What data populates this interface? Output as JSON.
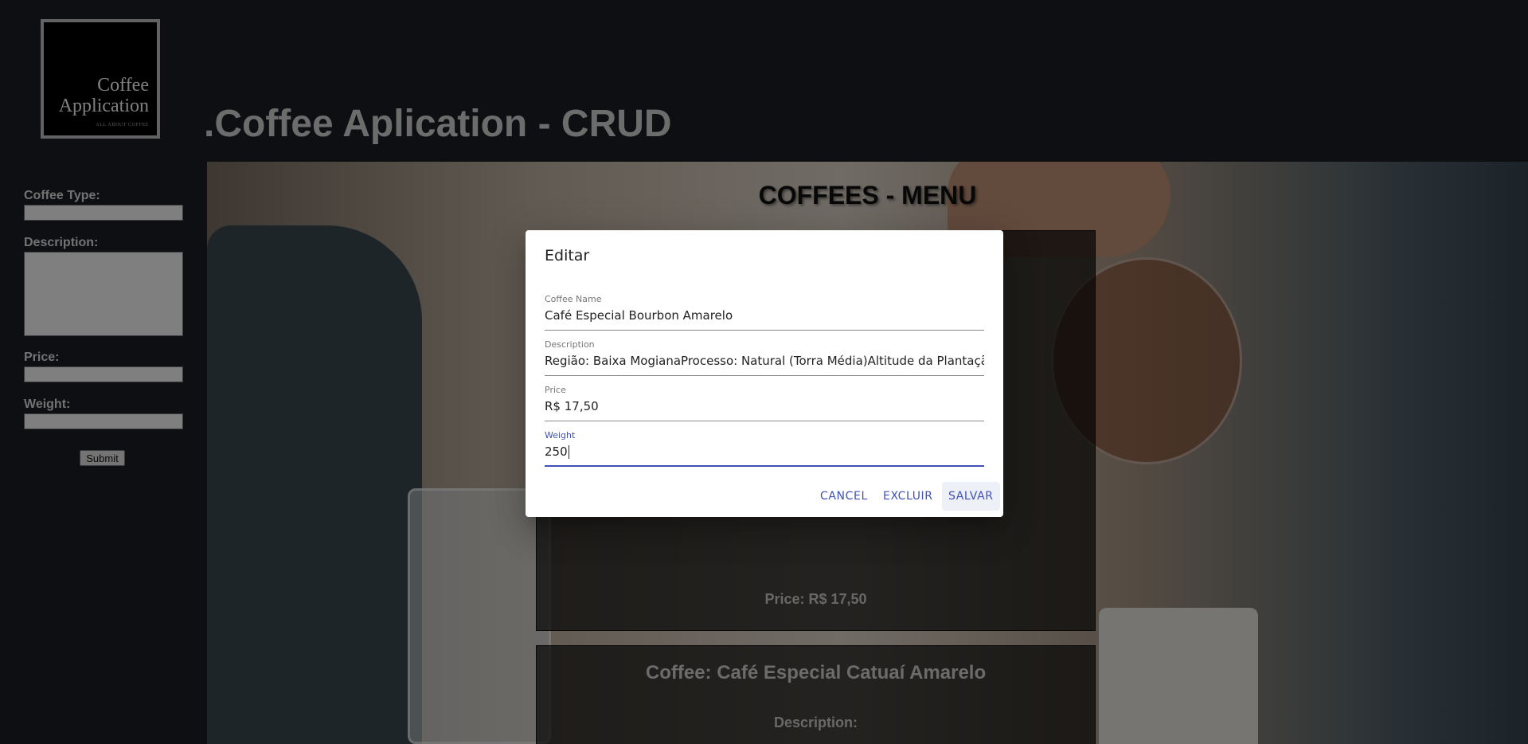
{
  "header": {
    "logo": {
      "line1": "Coffee",
      "line2": "Application",
      "tagline": "ALL ABOUT COFFEE"
    },
    "title": ".Coffee Aplication - CRUD"
  },
  "sidebar_form": {
    "type_label": "Coffee Type:",
    "description_label": "Description:",
    "price_label": "Price:",
    "weight_label": "Weight:",
    "submit_label": "Submit"
  },
  "menu": {
    "title": "COFFEES - MENU",
    "cards": [
      {
        "price": "Price: R$ 17,50"
      },
      {
        "name": "Coffee: Café Especial Catuaí Amarelo",
        "description_label": "Description:"
      }
    ]
  },
  "dialog": {
    "title": "Editar",
    "fields": {
      "name": {
        "label": "Coffee Name",
        "value": "Café Especial Bourbon Amarelo"
      },
      "description": {
        "label": "Description",
        "value": "Região: Baixa MogianaProcesso: Natural (Torra Média)Altitude da Plantação"
      },
      "price": {
        "label": "Price",
        "value": "R$ 17,50"
      },
      "weight": {
        "label": "Weight",
        "value": "250"
      }
    },
    "buttons": {
      "cancel": "Cancel",
      "excluir": "Excluir",
      "salvar": "Salvar"
    },
    "accent_color": "#3f51b5"
  }
}
